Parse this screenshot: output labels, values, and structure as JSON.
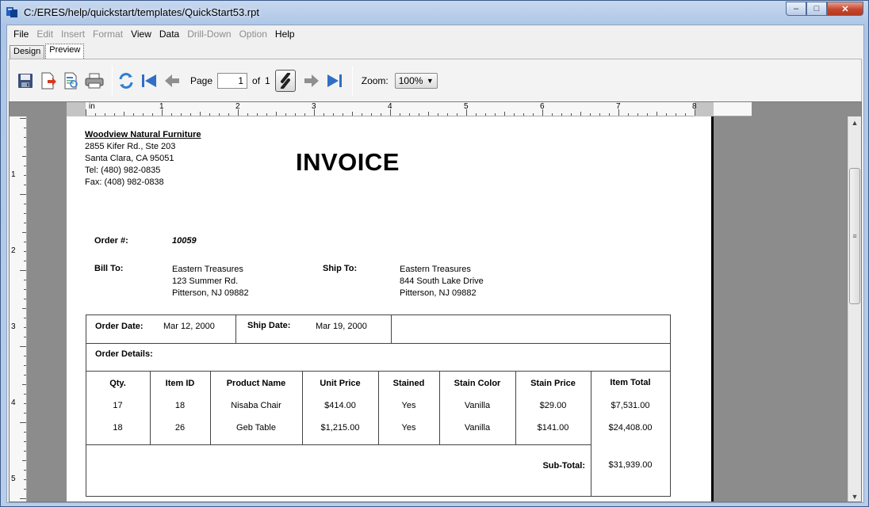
{
  "window": {
    "title": "C:/ERES/help/quickstart/templates/QuickStart53.rpt",
    "buttons": {
      "minimize": "–",
      "maximize": "□",
      "close": "✕"
    }
  },
  "menu": {
    "items": [
      {
        "label": "File",
        "enabled": true
      },
      {
        "label": "Edit",
        "enabled": false
      },
      {
        "label": "Insert",
        "enabled": false
      },
      {
        "label": "Format",
        "enabled": false
      },
      {
        "label": "View",
        "enabled": true
      },
      {
        "label": "Data",
        "enabled": true
      },
      {
        "label": "Drill-Down",
        "enabled": false
      },
      {
        "label": "Option",
        "enabled": false
      },
      {
        "label": "Help",
        "enabled": true
      }
    ]
  },
  "tabs": {
    "design": "Design",
    "preview": "Preview",
    "active": "Preview"
  },
  "toolbar": {
    "page_label": "Page",
    "page_value": "1",
    "of_label": "of",
    "page_total": "1",
    "zoom_label": "Zoom:",
    "zoom_value": "100%",
    "icons": [
      "save-icon",
      "export-icon",
      "export-html-icon",
      "print-icon",
      "refresh-icon",
      "first-page-icon",
      "previous-page-icon",
      "page-toggle-icon",
      "next-page-icon",
      "last-page-icon"
    ]
  },
  "ruler": {
    "unit": "in",
    "h_marks": [
      "1",
      "2",
      "3",
      "4",
      "5",
      "6",
      "7",
      "8"
    ],
    "v_marks": [
      "1",
      "2",
      "3",
      "4",
      "5"
    ]
  },
  "report": {
    "company": {
      "name": "Woodview Natural Furniture",
      "address1": "2855 Kifer Rd., Ste 203",
      "address2": "Santa Clara, CA 95051",
      "tel": "Tel: (480) 982-0835",
      "fax": "Fax: (408) 982-0838"
    },
    "title": "INVOICE",
    "order_no_label": "Order #:",
    "order_no": "10059",
    "bill_to_label": "Bill To:",
    "bill_to": [
      "Eastern Treasures",
      "123 Summer Rd.",
      "Pitterson, NJ 09882"
    ],
    "ship_to_label": "Ship To:",
    "ship_to": [
      "Eastern Treasures",
      "844 South Lake Drive",
      "Pitterson, NJ 09882"
    ],
    "order_date_label": "Order Date:",
    "order_date": "Mar 12, 2000",
    "ship_date_label": "Ship Date:",
    "ship_date": "Mar 19, 2000",
    "order_details_label": "Order Details:",
    "columns": [
      "Qty.",
      "Item ID",
      "Product Name",
      "Unit Price",
      "Stained",
      "Stain Color",
      "Stain Price",
      "Item Total"
    ],
    "rows": [
      [
        "17",
        "18",
        "Nisaba Chair",
        "$414.00",
        "Yes",
        "Vanilla",
        "$29.00",
        "$7,531.00"
      ],
      [
        "18",
        "26",
        "Geb Table",
        "$1,215.00",
        "Yes",
        "Vanilla",
        "$141.00",
        "$24,408.00"
      ]
    ],
    "subtotal_label": "Sub-Total:",
    "subtotal": "$31,939.00"
  }
}
